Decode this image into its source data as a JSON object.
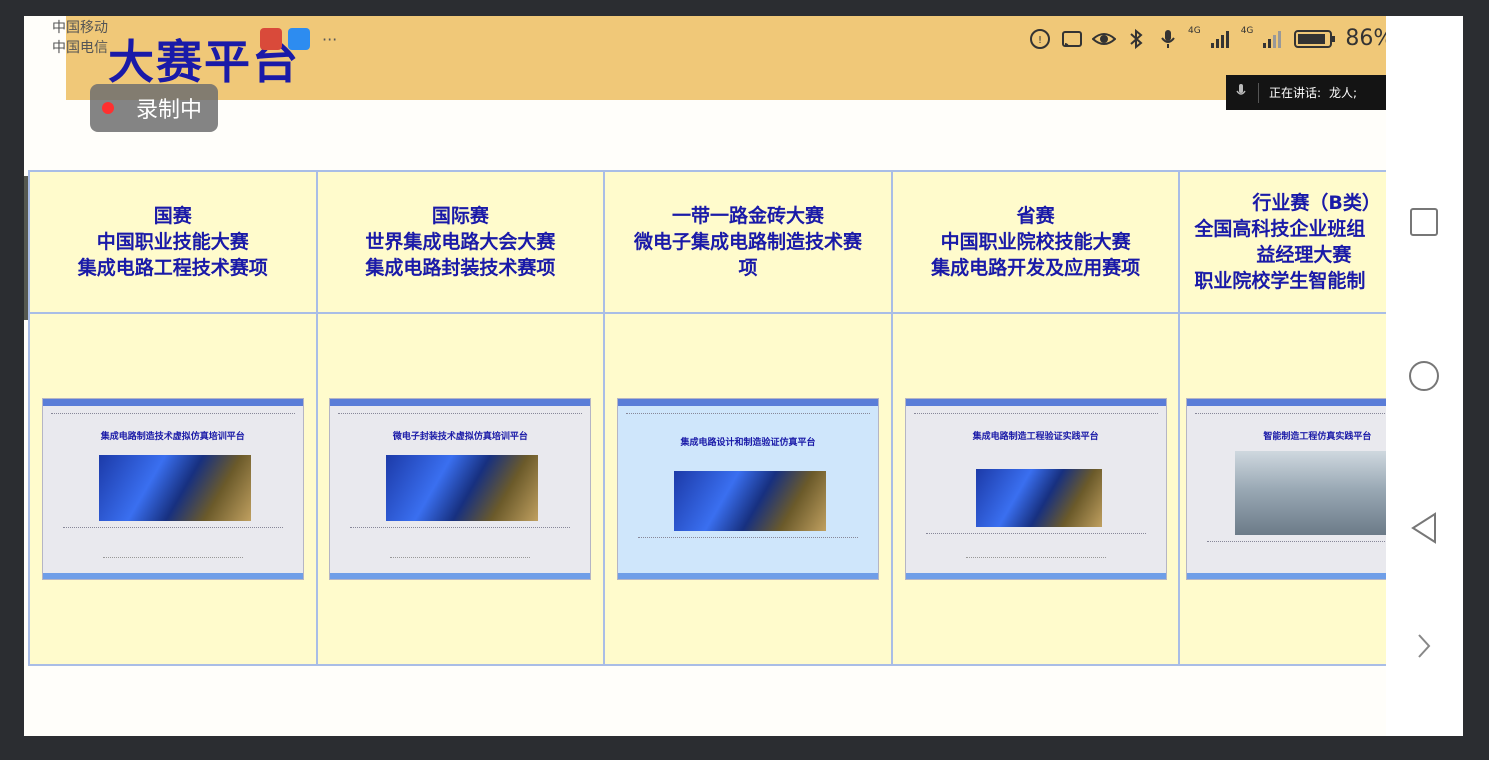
{
  "status_bar": {
    "carrier_1": "中国移动",
    "carrier_2": "中国电信",
    "more": "···",
    "battery": "86%",
    "signal_label_1": "4G",
    "signal_label_2": "4G"
  },
  "page": {
    "title": "大赛平台"
  },
  "recording": {
    "label": "录制中"
  },
  "meeting": {
    "speaking_prefix": "正在讲话:",
    "speaker": "龙人;"
  },
  "columns": [
    {
      "head_lines": [
        "国赛",
        "中国职业技能大赛",
        "集成电路工程技术赛项"
      ],
      "screenshot_title": "集成电路制造技术虚拟仿真培训平台"
    },
    {
      "head_lines": [
        "国际赛",
        "世界集成电路大会大赛",
        "集成电路封装技术赛项"
      ],
      "screenshot_title": "微电子封装技术虚拟仿真培训平台"
    },
    {
      "head_lines": [
        "一带一路金砖大赛",
        "微电子集成电路制造技术赛",
        "项"
      ],
      "screenshot_title": "集成电路设计和制造验证仿真平台"
    },
    {
      "head_lines": [
        "省赛",
        "中国职业院校技能大赛",
        "集成电路开发及应用赛项"
      ],
      "screenshot_title": "集成电路制造工程验证实践平台"
    },
    {
      "head_lines": [
        "行业赛（B类）",
        "全国高科技企业班组",
        "益经理大赛",
        "职业院校学生智能制"
      ],
      "screenshot_title": "智能制造工程仿真实践平台"
    }
  ],
  "colors": {
    "banner": "#f0c878",
    "title": "#1a1aa8",
    "cell_bg": "#fffbcc",
    "cell_border": "#a9bde6"
  },
  "nav": {
    "icons": [
      "square-icon",
      "circle-icon",
      "back-triangle-icon",
      "chevron-right-icon"
    ]
  }
}
